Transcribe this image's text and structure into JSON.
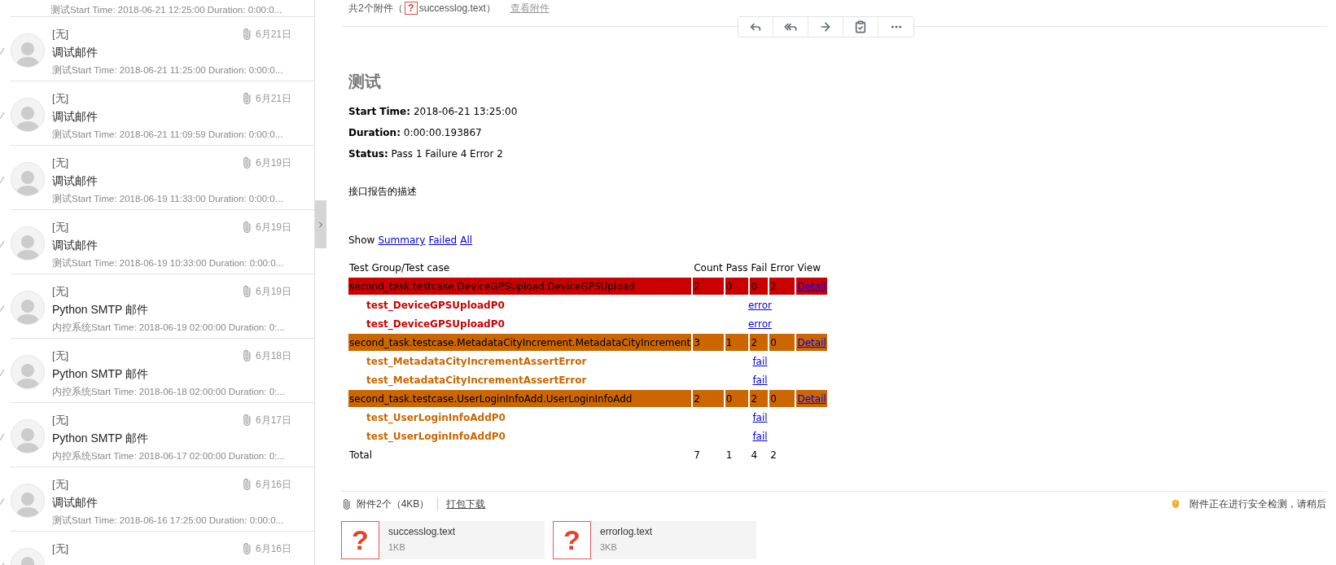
{
  "mail_list": {
    "items": [
      {
        "preview": "测试Start Time: 2018-06-21 12:25:00 Duration: 0:00:0..."
      },
      {
        "sender": "[无]",
        "date": "6月21日",
        "subject": "调试邮件",
        "preview": "测试Start Time: 2018-06-21 11:25:00 Duration: 0:00:0..."
      },
      {
        "sender": "[无]",
        "date": "6月21日",
        "subject": "调试邮件",
        "preview": "测试Start Time: 2018-06-21 11:09:59 Duration: 0:00:0..."
      },
      {
        "sender": "[无]",
        "date": "6月19日",
        "subject": "调试邮件",
        "preview": "测试Start Time: 2018-06-19 11:33:00 Duration: 0:00:0..."
      },
      {
        "sender": "[无]",
        "date": "6月19日",
        "subject": "调试邮件",
        "preview": "测试Start Time: 2018-06-19 10:33:00 Duration: 0:00:0..."
      },
      {
        "sender": "[无]",
        "date": "6月19日",
        "subject": "Python SMTP 邮件",
        "preview": "内控系统Start Time: 2018-06-19 02:00:00 Duration: 0:..."
      },
      {
        "sender": "[无]",
        "date": "6月18日",
        "subject": "Python SMTP 邮件",
        "preview": "内控系统Start Time: 2018-06-18 02:00:00 Duration: 0:..."
      },
      {
        "sender": "[无]",
        "date": "6月17日",
        "subject": "Python SMTP 邮件",
        "preview": "内控系统Start Time: 2018-06-17 02:00:00 Duration: 0:..."
      },
      {
        "sender": "[无]",
        "date": "6月16日",
        "subject": "调试邮件",
        "preview": "测试Start Time: 2018-06-16 17:25:00 Duration: 0:00:0..."
      },
      {
        "sender": "[无]",
        "date": "6月16日"
      }
    ]
  },
  "attachment_line": {
    "prefix": "共2个附件（",
    "icon": "?",
    "file": "successlog.text",
    "suffix": "）",
    "link": "查看附件"
  },
  "report": {
    "title": "测试",
    "fields": [
      {
        "label": "Start Time:",
        "value": "2018-06-21 13:25:00"
      },
      {
        "label": "Duration:",
        "value": "0:00:00.193867"
      },
      {
        "label": "Status:",
        "value": "Pass 1 Failure 4 Error 2"
      }
    ],
    "description": "接口报告的描述",
    "filter": {
      "label": "Show",
      "links": [
        "Summary",
        "Failed",
        "All"
      ]
    },
    "table": {
      "columns": [
        "Test Group/Test case",
        "Count",
        "Pass",
        "Fail",
        "Error",
        "View"
      ],
      "rows": [
        {
          "kind": "group",
          "color": "#cc0000",
          "name": "second_task.testcase.DeviceGPSUpload.DeviceGPSUpload",
          "count": "2",
          "pass": "0",
          "fail": "0",
          "error": "2",
          "view": "Detail"
        },
        {
          "kind": "case",
          "color": "#cc0000",
          "name": "test_DeviceGPSUploadP0",
          "status": "error"
        },
        {
          "kind": "case",
          "color": "#cc0000",
          "name": "test_DeviceGPSUploadP0",
          "status": "error"
        },
        {
          "kind": "group",
          "color": "#cc6600",
          "name": "second_task.testcase.MetadataCityIncrement.MetadataCityIncrement",
          "count": "3",
          "pass": "1",
          "fail": "2",
          "error": "0",
          "view": "Detail"
        },
        {
          "kind": "case",
          "color": "#cc6600",
          "name": "test_MetadataCityIncrementAssertError",
          "status": "fail"
        },
        {
          "kind": "case",
          "color": "#cc6600",
          "name": "test_MetadataCityIncrementAssertError",
          "status": "fail"
        },
        {
          "kind": "group",
          "color": "#cc6600",
          "name": "second_task.testcase.UserLoginInfoAdd.UserLoginInfoAdd",
          "count": "2",
          "pass": "0",
          "fail": "2",
          "error": "0",
          "view": "Detail"
        },
        {
          "kind": "case",
          "color": "#cc6600",
          "name": "test_UserLoginInfoAddP0",
          "status": "fail"
        },
        {
          "kind": "case",
          "color": "#cc6600",
          "name": "test_UserLoginInfoAddP0",
          "status": "fail"
        }
      ],
      "total": {
        "label": "Total",
        "count": "7",
        "pass": "1",
        "fail": "4",
        "error": "2"
      }
    }
  },
  "attachments": {
    "summary": "附件2个（4KB）",
    "download": "打包下载",
    "notice": "附件正在进行安全检测，请稍后",
    "files": [
      {
        "icon": "?",
        "name": "successlog.text",
        "size": "1KB"
      },
      {
        "icon": "?",
        "name": "errorlog.text",
        "size": "3KB"
      }
    ]
  }
}
